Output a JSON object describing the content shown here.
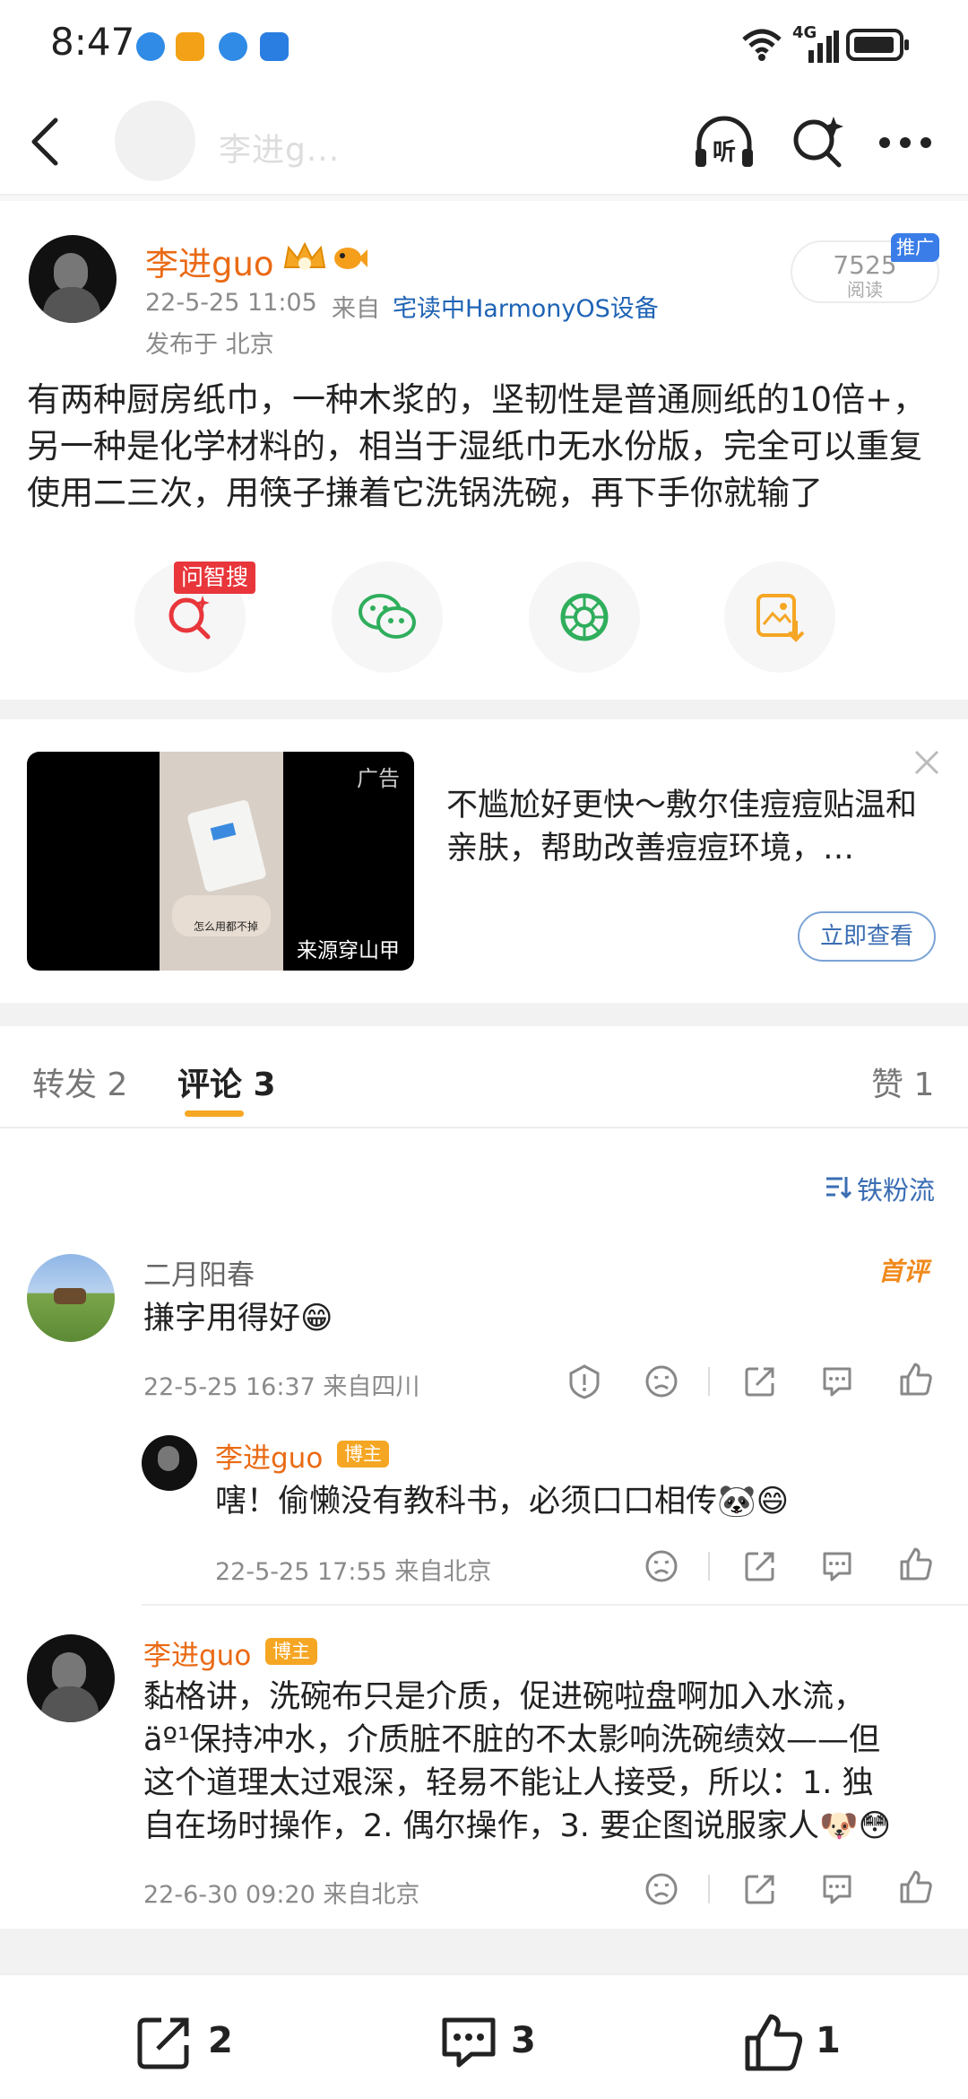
{
  "status_bar": {
    "time": "8:47",
    "network": "4G"
  },
  "title_bar": {
    "account_name": "李进g..."
  },
  "post": {
    "author": "李进guo",
    "time": "22-5-25 11:05",
    "source_prefix": "来自",
    "source": "宅读中HarmonyOS设备",
    "location": "发布于 北京",
    "read_count": "7525",
    "read_label": "阅读",
    "promo_badge": "推广",
    "text": "有两种厨房纸巾，一种木浆的，坚韧性是普通厕纸的10倍+，另一种是化学材料的，相当于湿纸巾无水份版，完全可以重复使用二三次，用筷子搛着它洗锅洗碗，再下手你就输了",
    "share_badge": "问智搜"
  },
  "ad": {
    "tag": "广告",
    "source": "来源穿山甲",
    "caption": "怎么用都不掉",
    "text": "不尴尬好更快～敷尔佳痘痘贴温和亲肤，帮助改善痘痘环境，…",
    "button": "立即查看"
  },
  "tabs": {
    "forward": "转发 2",
    "comments": "评论 3",
    "likes": "赞 1"
  },
  "sort_label": "铁粉流",
  "comments": [
    {
      "author": "二月阳春",
      "badge": "首评",
      "text": "搛字用得好😁",
      "meta": "22-5-25 16:37 来自四川",
      "reply": {
        "author": "李进guo",
        "badge": "博主",
        "text": "嗐！偷懒没有教科书，必须口口相传🐼😄",
        "meta": "22-5-25 17:55 来自北京"
      }
    },
    {
      "author": "李进guo",
      "badge": "博主",
      "text_lines": [
        "黏格讲，洗碗布只是介质，促进碗啦盘啊加入水流，",
        "äº¹保持冲水，介质脏不脏的不太影响洗碗绩效——但",
        "这个道理太过艰深，轻易不能让人接受，所以：1. 独",
        "自在场时操作，2. 偶尔操作，3. 要企图说服家人🐶😳"
      ],
      "meta": "22-6-30 09:20 来自北京"
    }
  ],
  "bottom_bar": {
    "forward_count": "2",
    "comment_count": "3",
    "like_count": "1"
  },
  "colors": {
    "orange": "#ea6a14",
    "blue_link": "#1e63b5",
    "gray_text": "#8a8a8a",
    "band": "#f2f2f2"
  }
}
